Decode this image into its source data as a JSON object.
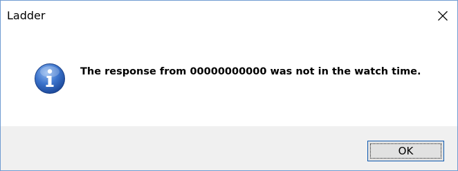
{
  "window": {
    "title": "Ladder",
    "close_icon": "close-icon"
  },
  "message": {
    "icon": "info-icon",
    "text": "The response from 00000000000 was not in the watch time."
  },
  "buttons": {
    "ok_label": "OK"
  },
  "colors": {
    "footer_bg": "#f0f0f0",
    "button_border": "#0f5ab0",
    "icon_blue": "#2a5fb8"
  }
}
